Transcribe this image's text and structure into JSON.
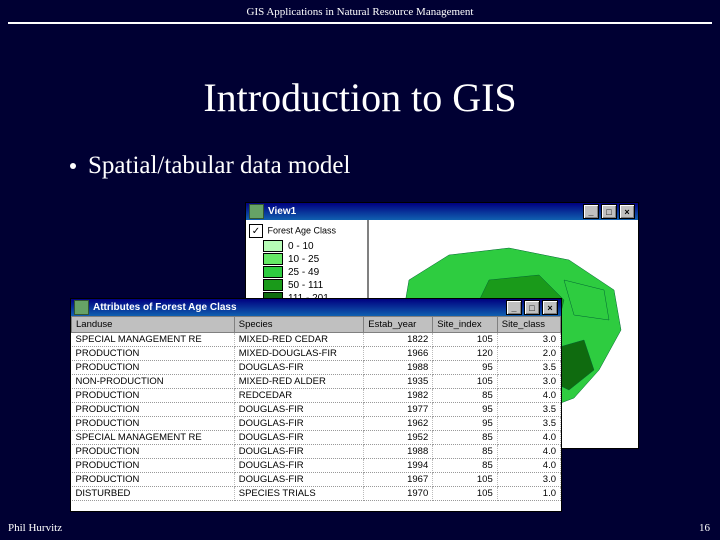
{
  "header": "GIS Applications in Natural Resource Management",
  "title": "Introduction to GIS",
  "bullet": "Spatial/tabular data model",
  "footer_left": "Phil Hurvitz",
  "footer_right": "16",
  "view_window": {
    "title": "View1",
    "legend_title": "Forest Age Class",
    "classes": [
      {
        "label": "0 - 10",
        "color": "#b7fcb7"
      },
      {
        "label": "10 - 25",
        "color": "#66e866"
      },
      {
        "label": "25 - 49",
        "color": "#2ecc40"
      },
      {
        "label": "50 - 111",
        "color": "#1a9a1a"
      },
      {
        "label": "111 - 201",
        "color": "#0f6b0f"
      }
    ]
  },
  "attr_window": {
    "title": "Attributes of Forest Age Class",
    "columns": [
      "Landuse",
      "Species",
      "Estab_year",
      "Site_index",
      "Site_class"
    ],
    "rows": [
      [
        "SPECIAL MANAGEMENT RE",
        "MIXED-RED CEDAR",
        "1822",
        "105",
        "3.0"
      ],
      [
        "PRODUCTION",
        "MIXED-DOUGLAS-FIR",
        "1966",
        "120",
        "2.0"
      ],
      [
        "PRODUCTION",
        "DOUGLAS-FIR",
        "1988",
        "95",
        "3.5"
      ],
      [
        "NON-PRODUCTION",
        "MIXED-RED ALDER",
        "1935",
        "105",
        "3.0"
      ],
      [
        "PRODUCTION",
        "REDCEDAR",
        "1982",
        "85",
        "4.0"
      ],
      [
        "PRODUCTION",
        "DOUGLAS-FIR",
        "1977",
        "95",
        "3.5"
      ],
      [
        "PRODUCTION",
        "DOUGLAS-FIR",
        "1962",
        "95",
        "3.5"
      ],
      [
        "SPECIAL MANAGEMENT RE",
        "DOUGLAS-FIR",
        "1952",
        "85",
        "4.0"
      ],
      [
        "PRODUCTION",
        "DOUGLAS-FIR",
        "1988",
        "85",
        "4.0"
      ],
      [
        "PRODUCTION",
        "DOUGLAS-FIR",
        "1994",
        "85",
        "4.0"
      ],
      [
        "PRODUCTION",
        "DOUGLAS-FIR",
        "1967",
        "105",
        "3.0"
      ],
      [
        "DISTURBED",
        "SPECIES TRIALS",
        "1970",
        "105",
        "1.0"
      ]
    ]
  }
}
